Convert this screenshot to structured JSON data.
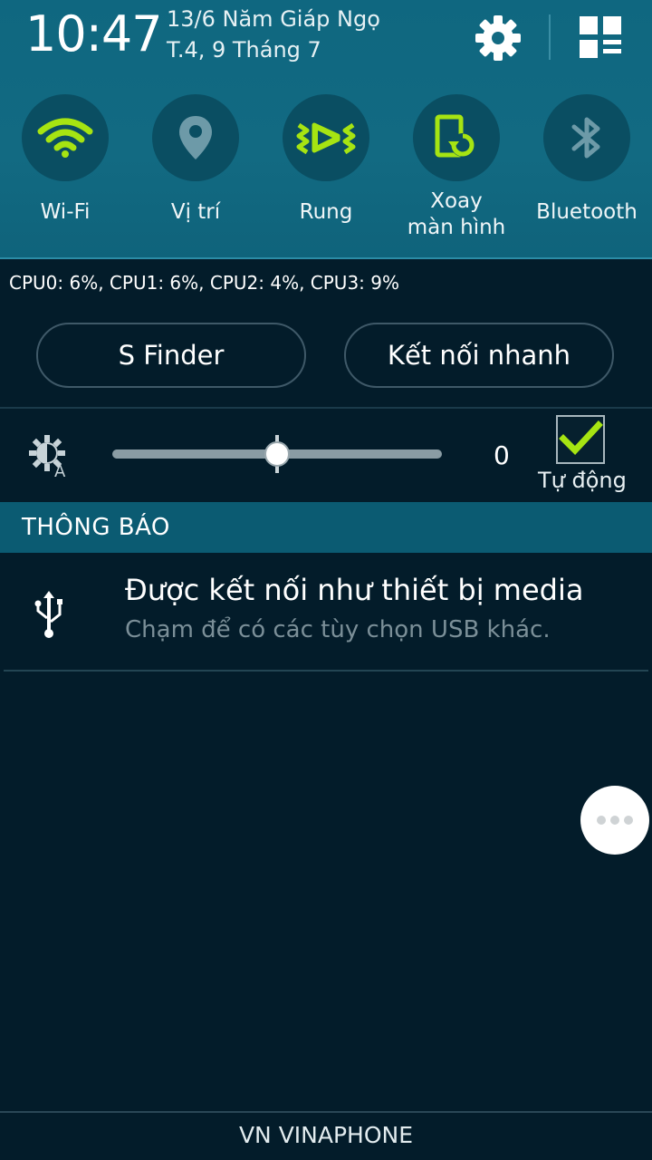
{
  "header": {
    "time": "10:47",
    "date_line1": "13/6 Năm Giáp Ngọ",
    "date_line2": "T.4, 9 Tháng 7"
  },
  "quick_settings": [
    {
      "id": "wifi",
      "label": "Wi-Fi",
      "icon": "wifi-icon",
      "active": true
    },
    {
      "id": "location",
      "label": "Vị trí",
      "icon": "location-pin-icon",
      "active": false
    },
    {
      "id": "vibrate",
      "label": "Rung",
      "icon": "vibrate-icon",
      "active": true
    },
    {
      "id": "rotate",
      "label": "Xoay\nmàn hình",
      "label_line1": "Xoay",
      "label_line2": "màn hình",
      "icon": "screen-rotation-icon",
      "active": true
    },
    {
      "id": "bluetooth",
      "label": "Bluetooth",
      "icon": "bluetooth-icon",
      "active": false
    }
  ],
  "cpu_text": "CPU0: 6%, CPU1: 6%, CPU2: 4%, CPU3: 9%",
  "buttons": {
    "s_finder": "S Finder",
    "quick_connect": "Kết nối nhanh"
  },
  "brightness": {
    "icon": "auto-brightness-icon",
    "level_fraction": 0.5,
    "value": "0",
    "auto_checked": true,
    "auto_label": "Tự động"
  },
  "notifications": {
    "header": "THÔNG BÁO",
    "items": [
      {
        "icon": "usb-icon",
        "title": "Được kết nối như thiết bị media",
        "subtitle": "Chạm để có các tùy chọn USB khác."
      }
    ]
  },
  "more_button_icon": "more-dots-icon",
  "carrier": "VN VINAPHONE",
  "colors": {
    "accent_green": "#a6e412",
    "header_bg": "#126a82",
    "panel_bg": "#031c2a",
    "inactive_icon": "#6d9aa8"
  }
}
